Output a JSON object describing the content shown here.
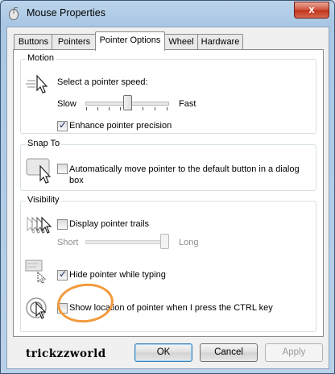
{
  "window": {
    "title": "Mouse Properties",
    "close_glyph": "x"
  },
  "tabs": [
    {
      "label": "Buttons",
      "active": false
    },
    {
      "label": "Pointers",
      "active": false
    },
    {
      "label": "Pointer Options",
      "active": true
    },
    {
      "label": "Wheel",
      "active": false
    },
    {
      "label": "Hardware",
      "active": false
    }
  ],
  "motion": {
    "group_label": "Motion",
    "speed_label": "Select a pointer speed:",
    "slow_label": "Slow",
    "fast_label": "Fast",
    "speed_value_fraction": 0.5,
    "enhance_label": "Enhance pointer precision",
    "enhance_checked": true
  },
  "snap_to": {
    "group_label": "Snap To",
    "auto_label": "Automatically move pointer to the default button in a dialog box",
    "auto_checked": false
  },
  "visibility": {
    "group_label": "Visibility",
    "trails_label": "Display pointer trails",
    "trails_checked": false,
    "short_label": "Short",
    "long_label": "Long",
    "trails_value_fraction": 1.0,
    "hide_label": "Hide pointer while typing",
    "hide_checked": true,
    "show_location_label": "Show location of pointer when I press the CTRL key",
    "show_location_checked": false
  },
  "watermark": "trickzzworld",
  "buttons": {
    "ok": "OK",
    "cancel": "Cancel",
    "apply": "Apply"
  },
  "colors": {
    "highlight_ring": "#f39a3c",
    "close_button": "#c0311b"
  },
  "icons": [
    "mouse-icon",
    "pointer-speed-icon",
    "snap-to-icon",
    "pointer-trails-icon",
    "hide-pointer-icon",
    "pointer-location-icon"
  ]
}
